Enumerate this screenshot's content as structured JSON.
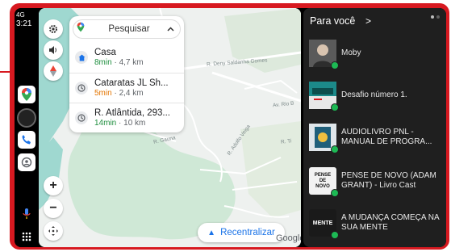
{
  "status": {
    "signal": "4G",
    "time": "3:21"
  },
  "map": {
    "search_placeholder": "Pesquisar",
    "destinations": [
      {
        "name": "Casa",
        "time": "8min",
        "distance": "· 4,7 km",
        "time_color": "green",
        "icon": "home-icon"
      },
      {
        "name": "Cataratas JL Sh...",
        "time": "5min",
        "distance": "· 2,4 km",
        "time_color": "orange",
        "icon": "clock-icon"
      },
      {
        "name": "R. Atlântida, 293...",
        "time": "14min",
        "distance": "· 10 km",
        "time_color": "green",
        "icon": "clock-icon"
      }
    ],
    "streets": [
      "R. Deny Saldanha Gomes",
      "Av. Rio B",
      "R. Adolfo Veiga",
      "R. Gauna",
      "R. Ti"
    ],
    "recenter_label": "Recentralizar",
    "attribution": "Google",
    "zoom_in": "+",
    "zoom_out": "−"
  },
  "panel": {
    "title": "Para você",
    "chevron": ">",
    "items": [
      {
        "label": "Moby"
      },
      {
        "label": "Desafio número 1."
      },
      {
        "label": "AUDIOLIVRO PNL - MANUAL DE PROGRA..."
      },
      {
        "label": "PENSE DE NOVO (ADAM GRANT) - Livro Cast",
        "thumb_text": "PENSE DE NOVO"
      },
      {
        "label": "A MUDANÇA COMEÇA NA SUA MENTE",
        "thumb_text": "MENTE"
      }
    ]
  },
  "colors": {
    "frame": "#d71920",
    "accent_green": "#1db954",
    "map_blue": "#1a73e8"
  }
}
